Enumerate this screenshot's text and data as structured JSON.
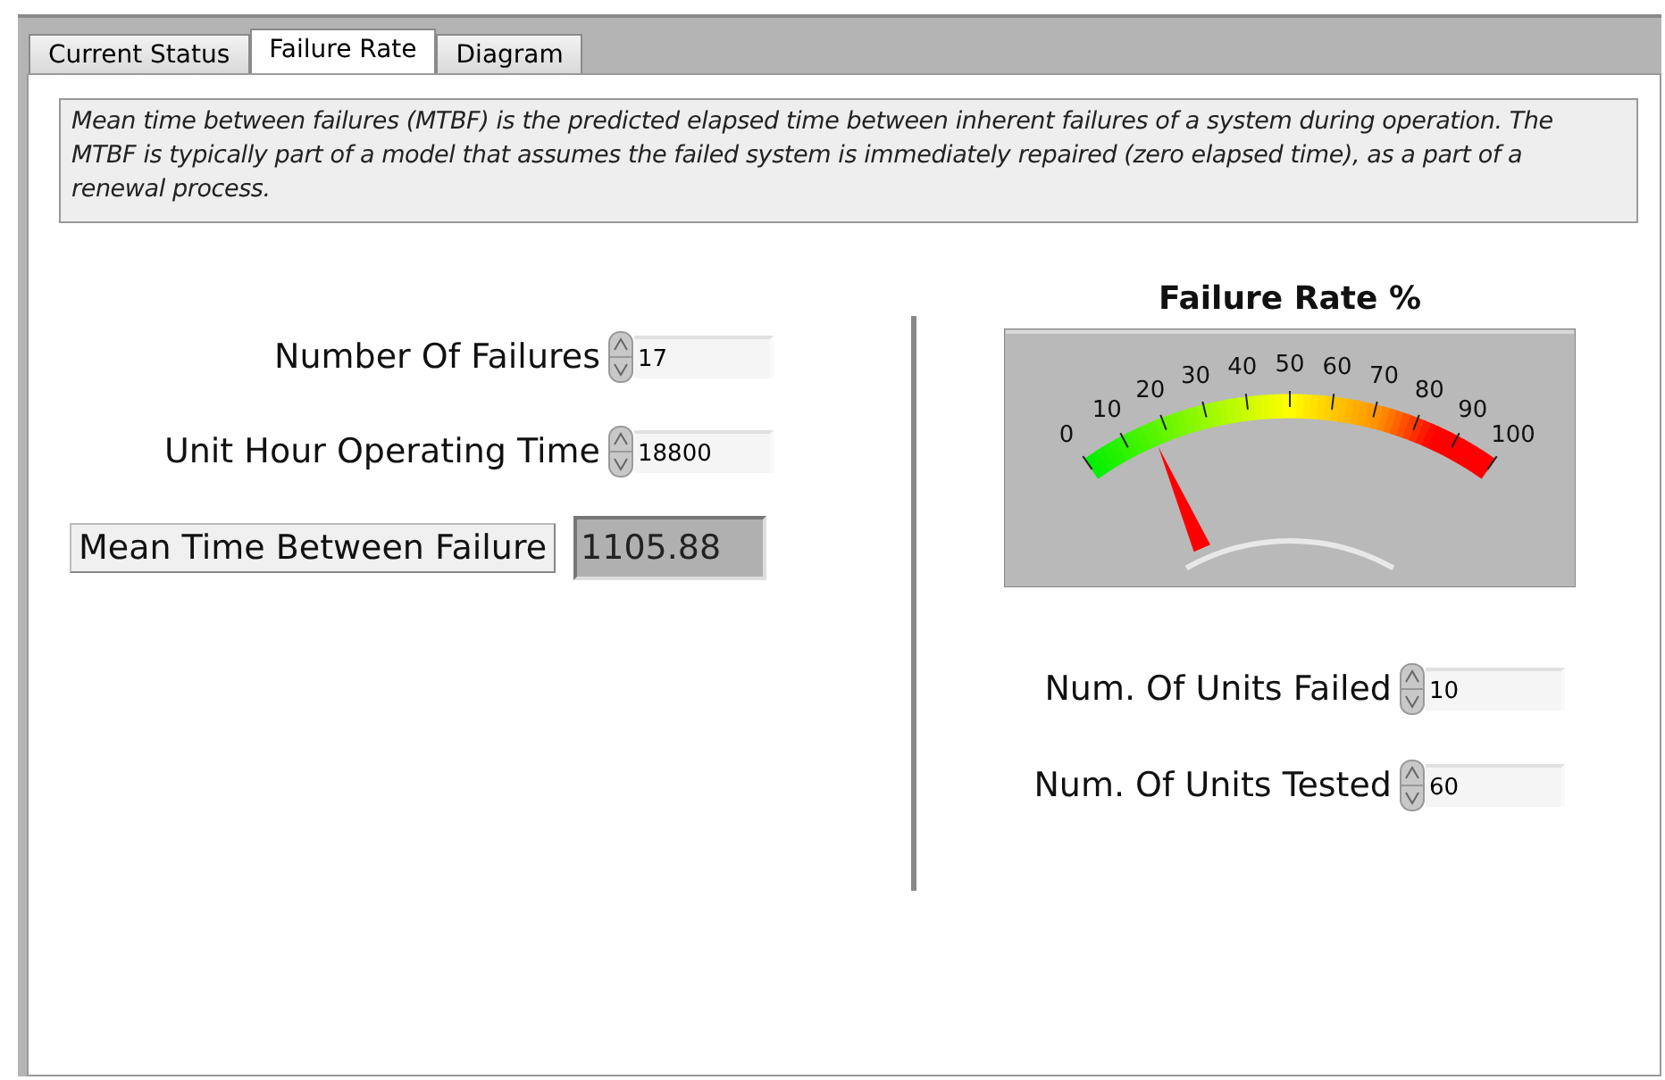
{
  "tabs": [
    {
      "label": "Current Status",
      "selected": false
    },
    {
      "label": "Failure Rate",
      "selected": true
    },
    {
      "label": "Diagram",
      "selected": false
    }
  ],
  "description": "Mean time between failures (MTBF) is the predicted elapsed time between inherent failures of a system during operation. The MTBF is typically part of a model that assumes the failed system is immediately repaired (zero elapsed time), as a part of a renewal process.",
  "left_inputs": [
    {
      "label": "Number Of Failures",
      "value": "17"
    },
    {
      "label": "Unit Hour Operating Time",
      "value": "18800"
    }
  ],
  "mtbf": {
    "button": "Mean Time Between Failure",
    "value": "1105.88"
  },
  "gauge": {
    "title": "Failure Rate %",
    "scale": [
      "0",
      "10",
      "20",
      "30",
      "40",
      "50",
      "60",
      "70",
      "80",
      "90",
      "100"
    ]
  },
  "right_inputs": [
    {
      "label": "Num. Of Units Failed",
      "value": "10"
    },
    {
      "label": "Num. Of Units Tested",
      "value": "60"
    }
  ]
}
